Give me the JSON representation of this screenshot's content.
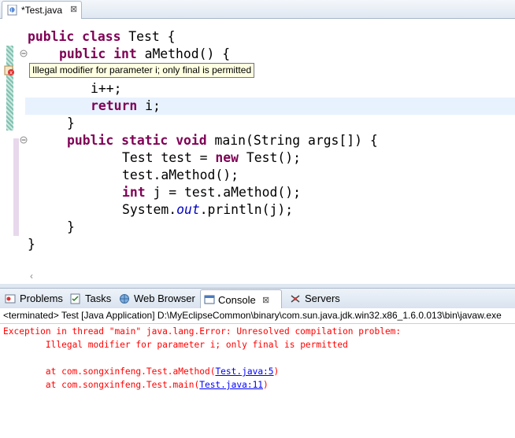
{
  "editor_tab": {
    "label": "*Test.java",
    "close_glyph": "⊠"
  },
  "code": {
    "l1": {
      "k1": "public",
      "k2": "class",
      "rest": " Test {"
    },
    "l2": {
      "k1": "public",
      "k2": "int",
      "rest": " aMethod() {"
    },
    "l4": {
      "rest": "i++;"
    },
    "l5": {
      "k1": "return",
      "rest": " i;"
    },
    "l6": {
      "rest": "}"
    },
    "l7": {
      "k1": "public",
      "k2": "static",
      "k3": "void",
      "rest": " main(String args[]) {"
    },
    "l8": {
      "pre": "Test test = ",
      "k1": "new",
      "rest": " Test();"
    },
    "l9": {
      "rest": "test.aMethod();"
    },
    "l10": {
      "k1": "int",
      "rest": " j = test.aMethod();"
    },
    "l11": {
      "pre": "System.",
      "field": "out",
      "rest": ".println(j);"
    },
    "l12": {
      "rest": "}"
    },
    "l13": {
      "rest": "}"
    }
  },
  "tooltip": "Illegal modifier for parameter i; only final is permitted",
  "view_tabs": {
    "problems": "Problems",
    "tasks": "Tasks",
    "web_browser": "Web Browser",
    "console": "Console",
    "console_close": "⊠",
    "servers": "Servers"
  },
  "console_header": "<terminated> Test [Java Application] D:\\MyEclipseCommon\\binary\\com.sun.java.jdk.win32.x86_1.6.0.013\\bin\\javaw.exe",
  "console_output": {
    "line1": "Exception in thread \"main\" java.lang.Error: Unresolved compilation problem: ",
    "line2": "\tIllegal modifier for parameter i; only final is permitted",
    "line4_pre": "\tat com.songxinfeng.Test.aMethod(",
    "line4_link": "Test.java:5",
    "line4_post": ")",
    "line5_pre": "\tat com.songxinfeng.Test.main(",
    "line5_link": "Test.java:11",
    "line5_post": ")"
  },
  "colors": {
    "keyword": "#7f0055",
    "error": "#ff0000",
    "link": "#0000ff",
    "field": "#0000c0"
  }
}
